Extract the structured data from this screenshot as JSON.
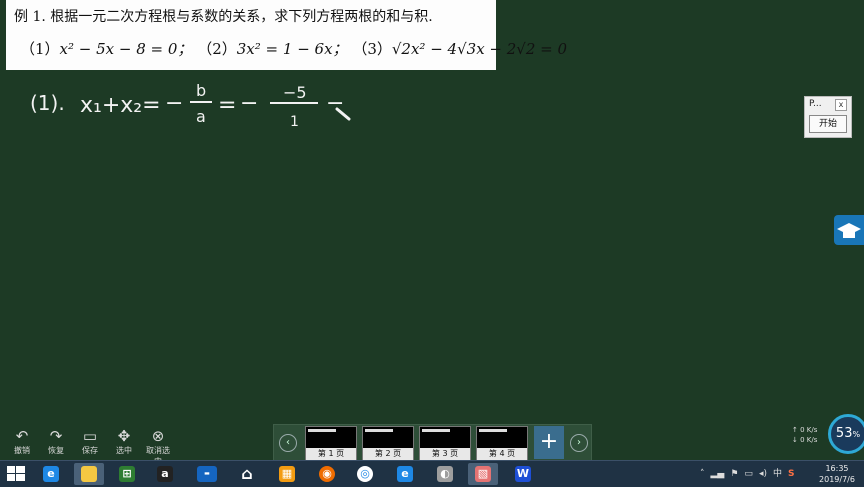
{
  "problem": {
    "title": "例 1.  根据一元二次方程根与系数的关系，求下列方程两根的和与积.",
    "eq1_label": "（1）",
    "eq1": "x² − 5x − 8 = 0；",
    "eq2_label": "（2）",
    "eq2": "3x² = 1 − 6x；",
    "eq3_label": "（3）",
    "eq3_a": "√2x² − 4√3x − 2√2 = 0"
  },
  "handwriting": {
    "label": "(1).",
    "lhs": "x₁+x₂=",
    "minus1": "−",
    "frac_num": "b",
    "frac_den": "a",
    "eq": "=",
    "minus2": "−",
    "num2": "−5",
    "den2": "1",
    "tail": "−"
  },
  "float_panel": {
    "title": "P...",
    "close": "x",
    "start": "开始"
  },
  "toolbar": [
    {
      "icon": "undo-icon",
      "glyph": "↶",
      "label": "撤销"
    },
    {
      "icon": "redo-icon",
      "glyph": "↷",
      "label": "恢复"
    },
    {
      "icon": "save-icon",
      "glyph": "▭",
      "label": "保存"
    },
    {
      "icon": "move-icon",
      "glyph": "✥",
      "label": "选中"
    },
    {
      "icon": "cancel-select-icon",
      "glyph": "⊗",
      "label": "取消选中"
    }
  ],
  "pager": {
    "pages": [
      "第 1 页",
      "第 2 页",
      "第 3 页",
      "第 4 页"
    ],
    "add": "+",
    "prev": "‹",
    "next": "›"
  },
  "net": {
    "up": "0 K/s",
    "down": "0 K/s",
    "percent": "53",
    "unit": "%"
  },
  "tray": {
    "ime": "中",
    "sogou": "S"
  },
  "clock": {
    "time": "16:35",
    "date": "2019/7/6"
  },
  "colors": {
    "board": "#1d3a25",
    "chalk": "#f2f2f2",
    "taskbar": "#1f3244"
  }
}
